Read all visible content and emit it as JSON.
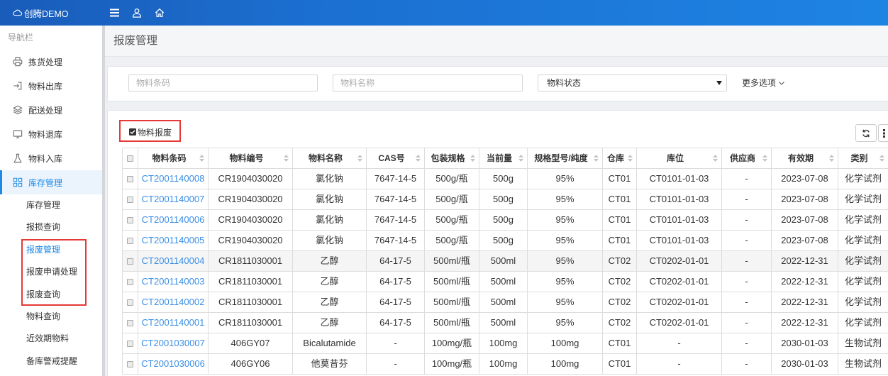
{
  "app": {
    "logo_text": "创腾DEMO",
    "logo_icon": "cloud-logo-icon"
  },
  "topbar": {
    "icons": [
      "menu-icon",
      "user-icon",
      "home-icon"
    ]
  },
  "sidebar": {
    "header": "导航栏",
    "items": [
      {
        "label": "拣货处理",
        "icon": "printer-icon"
      },
      {
        "label": "物料出库",
        "icon": "sign-out-icon"
      },
      {
        "label": "配送处理",
        "icon": "layers-icon"
      },
      {
        "label": "物料退库",
        "icon": "monitor-icon"
      },
      {
        "label": "物料入库",
        "icon": "flask-icon"
      }
    ],
    "active_group": {
      "label": "库存管理",
      "icon": "grid-icon",
      "children": [
        {
          "label": "库存管理"
        },
        {
          "label": "报损查询"
        },
        {
          "label": "报废管理",
          "active": true
        },
        {
          "label": "报废申请处理"
        },
        {
          "label": "报废查询"
        },
        {
          "label": "物料查询"
        },
        {
          "label": "近效期物料"
        },
        {
          "label": "备库警戒提醒"
        }
      ]
    }
  },
  "page": {
    "title": "报废管理"
  },
  "search": {
    "barcode_placeholder": "物料条码",
    "name_placeholder": "物料名称",
    "status_select_value": "物料状态",
    "more_options": "更多选项"
  },
  "toolbar": {
    "scrap_button": "物料报废",
    "scrap_icon": "check-square-icon",
    "refresh_icon": "refresh-icon",
    "columns_icon": "columns-icon"
  },
  "table": {
    "columns": [
      "物料条码",
      "物料编号",
      "物料名称",
      "CAS号",
      "包装规格",
      "当前量",
      "规格型号/纯度",
      "仓库",
      "库位",
      "供应商",
      "有效期",
      "类别"
    ],
    "rows": [
      [
        "CT2001140008",
        "CR1904030020",
        "氯化钠",
        "7647-14-5",
        "500g/瓶",
        "500g",
        "95%",
        "CT01",
        "CT0101-01-03",
        "-",
        "2023-07-08",
        "化学试剂"
      ],
      [
        "CT2001140007",
        "CR1904030020",
        "氯化钠",
        "7647-14-5",
        "500g/瓶",
        "500g",
        "95%",
        "CT01",
        "CT0101-01-03",
        "-",
        "2023-07-08",
        "化学试剂"
      ],
      [
        "CT2001140006",
        "CR1904030020",
        "氯化钠",
        "7647-14-5",
        "500g/瓶",
        "500g",
        "95%",
        "CT01",
        "CT0101-01-03",
        "-",
        "2023-07-08",
        "化学试剂"
      ],
      [
        "CT2001140005",
        "CR1904030020",
        "氯化钠",
        "7647-14-5",
        "500g/瓶",
        "500g",
        "95%",
        "CT01",
        "CT0101-01-03",
        "-",
        "2023-07-08",
        "化学试剂"
      ],
      [
        "CT2001140004",
        "CR1811030001",
        "乙醇",
        "64-17-5",
        "500ml/瓶",
        "500ml",
        "95%",
        "CT02",
        "CT0202-01-01",
        "-",
        "2022-12-31",
        "化学试剂"
      ],
      [
        "CT2001140003",
        "CR1811030001",
        "乙醇",
        "64-17-5",
        "500ml/瓶",
        "500ml",
        "95%",
        "CT02",
        "CT0202-01-01",
        "-",
        "2022-12-31",
        "化学试剂"
      ],
      [
        "CT2001140002",
        "CR1811030001",
        "乙醇",
        "64-17-5",
        "500ml/瓶",
        "500ml",
        "95%",
        "CT02",
        "CT0202-01-01",
        "-",
        "2022-12-31",
        "化学试剂"
      ],
      [
        "CT2001140001",
        "CR1811030001",
        "乙醇",
        "64-17-5",
        "500ml/瓶",
        "500ml",
        "95%",
        "CT02",
        "CT0202-01-01",
        "-",
        "2022-12-31",
        "化学试剂"
      ],
      [
        "CT2001030007",
        "406GY07",
        "Bicalutamide",
        "-",
        "100mg/瓶",
        "100mg",
        "100mg",
        "CT01",
        "-",
        "-",
        "2030-01-03",
        "生物试剂"
      ],
      [
        "CT2001030006",
        "406GY06",
        "他莫昔芬",
        "-",
        "100mg/瓶",
        "100mg",
        "100mg",
        "CT01",
        "-",
        "-",
        "2030-01-03",
        "生物试剂"
      ]
    ]
  },
  "colors": {
    "topbar": "#1b6fd0",
    "accent": "#1e88e5",
    "link": "#3a8ee6",
    "annotation": "#e53935",
    "hover_row": "#f5f5f5"
  }
}
